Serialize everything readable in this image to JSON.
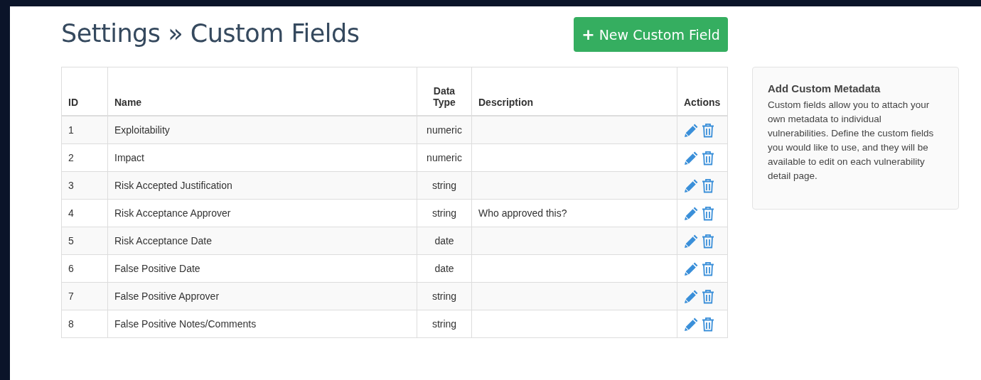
{
  "page": {
    "title": "Settings » Custom Fields",
    "new_button": {
      "icon": "+",
      "label": "New Custom Field"
    }
  },
  "table": {
    "columns": [
      "ID",
      "Name",
      "Data Type",
      "Description",
      "Actions"
    ],
    "rows": [
      {
        "id": "1",
        "name": "Exploitability",
        "data_type": "numeric",
        "description": ""
      },
      {
        "id": "2",
        "name": "Impact",
        "data_type": "numeric",
        "description": ""
      },
      {
        "id": "3",
        "name": "Risk Accepted Justification",
        "data_type": "string",
        "description": ""
      },
      {
        "id": "4",
        "name": "Risk Acceptance Approver",
        "data_type": "string",
        "description": "Who approved this?"
      },
      {
        "id": "5",
        "name": "Risk Acceptance Date",
        "data_type": "date",
        "description": ""
      },
      {
        "id": "6",
        "name": "False Positive Date",
        "data_type": "date",
        "description": ""
      },
      {
        "id": "7",
        "name": "False Positive Approver",
        "data_type": "string",
        "description": ""
      },
      {
        "id": "8",
        "name": "False Positive Notes/Comments",
        "data_type": "string",
        "description": ""
      }
    ]
  },
  "info_panel": {
    "title": "Add Custom Metadata",
    "text": "Custom fields allow you to attach your own metadata to individual vulnerabilities. Define the custom fields you would like to use, and they will be available to edit on each vulnerability detail page."
  }
}
